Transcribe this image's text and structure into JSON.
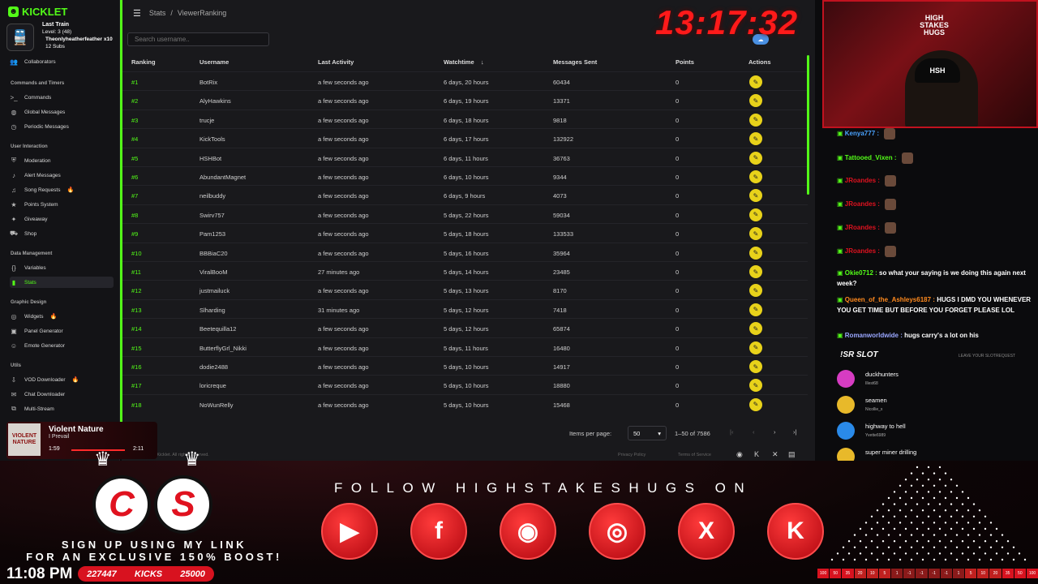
{
  "sidebar": {
    "logo": "KICKLET",
    "sections": [
      {
        "title": "Commands and Timers",
        "items": [
          {
            "label": "Commands",
            "icon": "terminal-icon"
          },
          {
            "label": "Global Messages",
            "icon": "globe-icon"
          },
          {
            "label": "Periodic Messages",
            "icon": "clock-icon"
          }
        ]
      },
      {
        "title": "User Interaction",
        "items": [
          {
            "label": "Moderation",
            "icon": "shield-icon"
          },
          {
            "label": "Alert Messages",
            "icon": "bell-icon"
          },
          {
            "label": "Song Requests",
            "icon": "music-icon"
          },
          {
            "label": "Points System",
            "icon": "star-icon"
          },
          {
            "label": "Giveaway",
            "icon": "gift-icon"
          },
          {
            "label": "Shop",
            "icon": "cart-icon"
          }
        ]
      },
      {
        "title": "Data Management",
        "items": [
          {
            "label": "Variables",
            "icon": "variable-icon"
          },
          {
            "label": "Stats",
            "icon": "bar-chart-icon"
          }
        ]
      },
      {
        "title": "Graphic Design",
        "items": [
          {
            "label": "Widgets",
            "icon": "widget-icon"
          },
          {
            "label": "Panel Generator",
            "icon": "panel-icon"
          },
          {
            "label": "Emote Generator",
            "icon": "emote-icon"
          }
        ]
      },
      {
        "title": "Utils",
        "items": [
          {
            "label": "VOD Downloader",
            "icon": "download-icon"
          },
          {
            "label": "Chat Downloader",
            "icon": "chat-download-icon"
          },
          {
            "label": "Multi-Stream",
            "icon": "multistream-icon"
          }
        ]
      }
    ],
    "collaborators": "Collaborators"
  },
  "train": {
    "title": "Last Train",
    "level": "Level: 3 (48)",
    "user": "Theonlyheatherfeather x10",
    "subs": "12 Subs"
  },
  "breadcrumb": {
    "root": "Stats",
    "sep": "/",
    "current": "ViewerRanking"
  },
  "search": {
    "placeholder": "Search username.."
  },
  "table": {
    "headers": [
      "Ranking",
      "Username",
      "Last Activity",
      "Watchtime",
      "Messages Sent",
      "Points",
      "Actions"
    ],
    "rows": [
      [
        "#1",
        "BotRix",
        "a few seconds ago",
        "6 days, 20 hours",
        "60434",
        "0"
      ],
      [
        "#2",
        "AlyHawkins",
        "a few seconds ago",
        "6 days, 19 hours",
        "13371",
        "0"
      ],
      [
        "#3",
        "trucje",
        "a few seconds ago",
        "6 days, 18 hours",
        "9818",
        "0"
      ],
      [
        "#4",
        "KickTools",
        "a few seconds ago",
        "6 days, 17 hours",
        "132922",
        "0"
      ],
      [
        "#5",
        "HSHBot",
        "a few seconds ago",
        "6 days, 11 hours",
        "36763",
        "0"
      ],
      [
        "#6",
        "AbundantMagnet",
        "a few seconds ago",
        "6 days, 10 hours",
        "9344",
        "0"
      ],
      [
        "#7",
        "neilbuddy",
        "a few seconds ago",
        "6 days, 9 hours",
        "4073",
        "0"
      ],
      [
        "#8",
        "Swirv757",
        "a few seconds ago",
        "5 days, 22 hours",
        "59034",
        "0"
      ],
      [
        "#9",
        "Pam1253",
        "a few seconds ago",
        "5 days, 18 hours",
        "133533",
        "0"
      ],
      [
        "#10",
        "BBBiaC20",
        "a few seconds ago",
        "5 days, 16 hours",
        "35964",
        "0"
      ],
      [
        "#11",
        "ViralBooM",
        "27 minutes ago",
        "5 days, 14 hours",
        "23485",
        "0"
      ],
      [
        "#12",
        "justmailuck",
        "a few seconds ago",
        "5 days, 13 hours",
        "8170",
        "0"
      ],
      [
        "#13",
        "Slharding",
        "31 minutes ago",
        "5 days, 12 hours",
        "7418",
        "0"
      ],
      [
        "#14",
        "Beetequilla12",
        "a few seconds ago",
        "5 days, 12 hours",
        "65874",
        "0"
      ],
      [
        "#15",
        "ButterflyGrl_Nikki",
        "a few seconds ago",
        "5 days, 11 hours",
        "16480",
        "0"
      ],
      [
        "#16",
        "dodie2488",
        "a few seconds ago",
        "5 days, 10 hours",
        "14917",
        "0"
      ],
      [
        "#17",
        "loricreque",
        "a few seconds ago",
        "5 days, 10 hours",
        "18880",
        "0"
      ],
      [
        "#18",
        "NoWunRelly",
        "a few seconds ago",
        "5 days, 10 hours",
        "15468",
        "0"
      ]
    ]
  },
  "pager": {
    "items_label": "Items per page:",
    "per_page": "50",
    "range": "1–50 of 7586"
  },
  "footer": {
    "copyright": "© 2024 Kicklet. All rights reserved.",
    "privacy": "Privacy Policy",
    "terms": "Terms of Service"
  },
  "overlay": {
    "clock": "13:17:32",
    "cam_title": "HIGH STAKES HUGS",
    "cam_hat": "HSH",
    "chat": [
      {
        "user": "Kenya777 :",
        "msg": "",
        "color": "#4aa3ff"
      },
      {
        "user": "Tattooed_Vixen :",
        "msg": "",
        "color": "#53fc18"
      },
      {
        "user": "JRoandes :",
        "msg": "",
        "color": "#e0121f"
      },
      {
        "user": "JRoandes :",
        "msg": "",
        "color": "#e0121f"
      },
      {
        "user": "JRoandes :",
        "msg": "",
        "color": "#e0121f"
      },
      {
        "user": "JRoandes :",
        "msg": "",
        "color": "#e0121f"
      },
      {
        "user": "Okie0712 :",
        "msg": "so what your saying is we doing this again next week?",
        "color": "#53fc18"
      },
      {
        "user": "Queen_of_the_Ashleys6187 :",
        "msg": "HUGS I DMD YOU WHENEVER YOU GET TIME BUT BEFORE YOU FORGET PLEASE LOL",
        "color": "#ff8a1e"
      },
      {
        "user": "Romanworldwide :",
        "msg": "hugs carry's a lot on his",
        "color": "#9aa7ff"
      }
    ],
    "sr_title": "!SR SLOT",
    "sr_hint": "LEAVE YOUR SLOTREQUEST",
    "sr_items": [
      {
        "song": "duckhunters",
        "req": "Illest68",
        "color": "#d63cc2"
      },
      {
        "song": "seamen",
        "req": "Nicollie_x",
        "color": "#e8b92a"
      },
      {
        "song": "highway to hell",
        "req": "Yvette6989",
        "color": "#2a8ae8"
      },
      {
        "song": "super miner drilling",
        "req": "",
        "color": "#e8b92a"
      }
    ],
    "np": {
      "title": "Violent Nature",
      "artist": "I Prevail",
      "current": "1:59",
      "total": "2:11",
      "art": "VIOLENT NATURE"
    },
    "cs": [
      "C",
      "S"
    ],
    "signup": [
      "SIGN UP USING MY LINK",
      "FOR AN EXCLUSIVE 150% BOOST!"
    ],
    "time": "11:08 PM",
    "kicks": {
      "a": "227447",
      "label": "KICKS",
      "b": "25000"
    },
    "follow": "FOLLOW HIGHSTAKESHUGS ON",
    "socials": [
      "youtube-icon",
      "facebook-icon",
      "discord-icon",
      "instagram-icon",
      "x-icon",
      "kick-icon"
    ],
    "plinko": [
      "100",
      "50",
      "35",
      "20",
      "10",
      "5",
      "1",
      "-1",
      "-1",
      "-1",
      "-1",
      "1",
      "5",
      "10",
      "20",
      "35",
      "50",
      "100"
    ]
  }
}
